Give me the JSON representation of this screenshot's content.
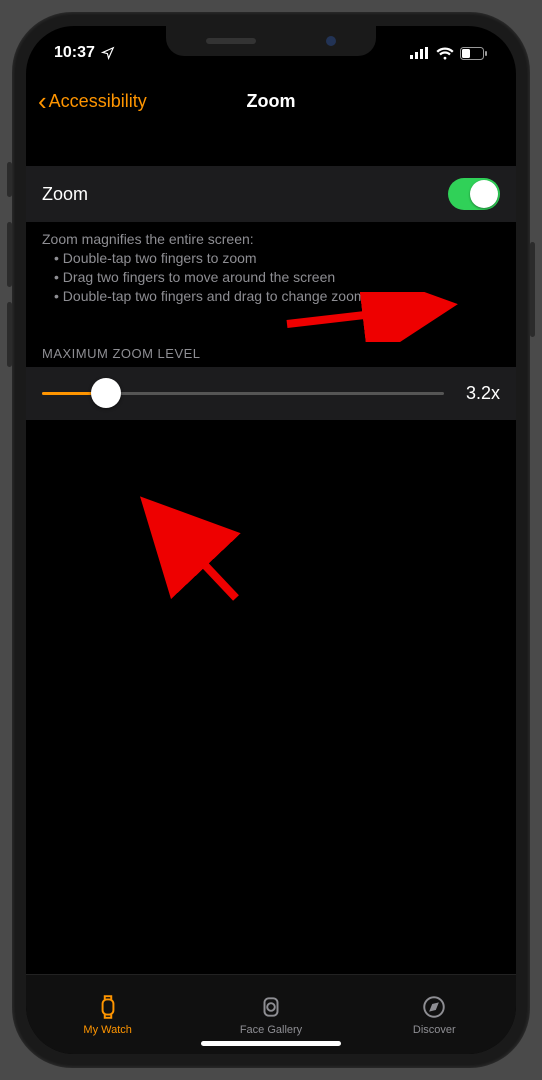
{
  "status": {
    "time": "10:37",
    "location_icon": "◤"
  },
  "nav": {
    "back_label": "Accessibility",
    "title": "Zoom"
  },
  "zoom": {
    "row_label": "Zoom",
    "toggle_on": true,
    "desc_heading": "Zoom magnifies the entire screen:",
    "desc_items": [
      "Double-tap two fingers to zoom",
      "Drag two fingers to move around the screen",
      "Double-tap two fingers and drag to change zoom"
    ]
  },
  "slider": {
    "section_header": "MAXIMUM ZOOM LEVEL",
    "value_label": "3.2x",
    "percent": 16
  },
  "tabs": {
    "my_watch": "My Watch",
    "face_gallery": "Face Gallery",
    "discover": "Discover"
  }
}
